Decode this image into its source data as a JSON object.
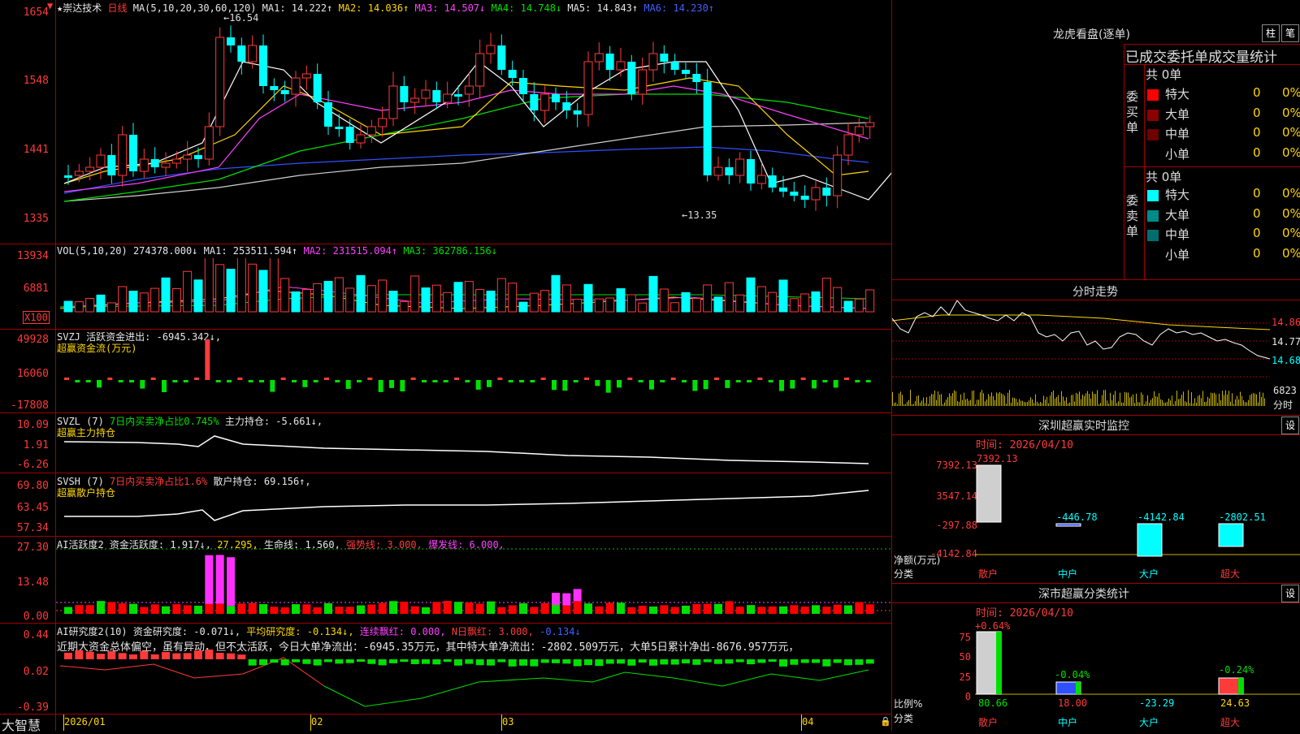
{
  "colors": {
    "up": "#ff3a3a",
    "down": "#00ffff",
    "ma1": "#ffffff",
    "ma2": "#ffd700",
    "ma3": "#ff40ff",
    "ma4": "#00e000",
    "ma5": "#cfcfcf",
    "ma6": "#3050ff"
  },
  "main": {
    "title": "★崇达技术",
    "period": "日线",
    "ma_params": "MA(5,10,20,30,60,120)",
    "ma1": "MA1: 14.222↑",
    "ma2": "MA2: 14.036↑",
    "ma3": "MA3: 14.507↓",
    "ma4": "MA4: 14.748↓",
    "ma5": "MA5: 14.843↑",
    "ma6": "MA6: 14.230↑",
    "y_ticks": [
      "1654",
      "1548",
      "1441",
      "1335"
    ],
    "high_label": "←16.54",
    "low_label": "←13.35"
  },
  "vol": {
    "label": "VOL(5,10,20)",
    "value": "274378.000↓",
    "ma1": "MA1: 253511.594↑",
    "ma2": "MA2: 231515.094↑",
    "ma3": "MA3: 362786.156↓",
    "y_ticks": [
      "13934",
      "6881",
      "X100"
    ]
  },
  "svzj": {
    "label": "SVZJ",
    "text": "活跃资金进出: -6945.342↓,",
    "sub": "超赢资金流(万元)",
    "y_ticks": [
      "49928",
      "16060",
      "-17808"
    ]
  },
  "svzl": {
    "label": "SVZL (7)",
    "text1": "7日内买卖净占比0.745%",
    "text2": "主力持仓: -5.661↓,",
    "sub": "超赢主力持仓",
    "y_ticks": [
      "10.09",
      "1.91",
      "-6.26"
    ]
  },
  "svsh": {
    "label": "SVSH (7)",
    "text1": "7日内买卖净占比1.6%",
    "text2": "散户持仓: 69.156↑,",
    "sub": "超赢散户持仓",
    "y_ticks": [
      "69.80",
      "63.45",
      "57.34"
    ]
  },
  "ai1": {
    "label": "AI活跃度2",
    "t1": "资金活跃度: 1.917↓,",
    "t2": "27.295,",
    "t3": "生命线: 1.560,",
    "t4": "强势线: 3.000,",
    "t5": "爆发线: 6.000,",
    "y_ticks": [
      "27.30",
      "13.48",
      "0.00"
    ]
  },
  "ai2": {
    "label": "AI研究度2(10)",
    "t1": "资金研究度: -0.071↓,",
    "t2": "平均研究度: -0.134↓,",
    "t3": "连续飘红: 0.000,",
    "t4": "N日飘红: 3.000,",
    "t5": "-0.134↓",
    "desc": "近期大资金总体偏空，虽有异动，但不太活跃，今日大单净流出：-6945.35万元，其中特大单净流出：-2802.509万元，大单5日累计净出-8676.957万元，",
    "y_ticks": [
      "0.44",
      "0.02",
      "-0.39"
    ]
  },
  "xaxis": {
    "brand": "大智慧",
    "labels": [
      "2026/01",
      "02",
      "03",
      "04"
    ]
  },
  "right": {
    "lhkp_title": "龙虎看盘(逐单)",
    "btn1": "柱",
    "btn2": "笔",
    "header": "已成交委托单成交量统计",
    "buy_side": "委买单",
    "sell_side": "委卖单",
    "buy_total": "共 0单",
    "sell_total": "共 0单",
    "buy_rows": [
      {
        "name": "特大",
        "num": "0",
        "pct": "0%"
      },
      {
        "name": "大单",
        "num": "0",
        "pct": "0%"
      },
      {
        "name": "中单",
        "num": "0",
        "pct": "0%"
      },
      {
        "name": "小单",
        "num": "0",
        "pct": "0%"
      }
    ],
    "sell_rows": [
      {
        "name": "特大",
        "num": "0",
        "pct": "0%"
      },
      {
        "name": "大单",
        "num": "0",
        "pct": "0%"
      },
      {
        "name": "中单",
        "num": "0",
        "pct": "0%"
      },
      {
        "name": "小单",
        "num": "0",
        "pct": "0%"
      }
    ],
    "fs_title": "分时走势",
    "fs_prices": [
      "14.86",
      "14.77",
      "14.68"
    ],
    "fs_vol": "6823",
    "fs_label": "分时",
    "m1_title": "深圳超赢实时监控",
    "m1_btn": "设",
    "m1_time": "时间: 2026/04/10",
    "m1_y": [
      "7392.13",
      "3547.14",
      "-297.88",
      "-4142.84"
    ],
    "m1_unit": "净额(万元)",
    "m1_cat": "分类",
    "m1_vals": [
      {
        "name": "散户",
        "val": "7392.13"
      },
      {
        "name": "中户",
        "val": "-446.78"
      },
      {
        "name": "大户",
        "val": "-4142.84"
      },
      {
        "name": "超大",
        "val": "-2802.51"
      }
    ],
    "m2_title": "深市超赢分类统计",
    "m2_btn": "设",
    "m2_time": "时间: 2026/04/10",
    "m2_y": [
      "75",
      "50",
      "25",
      "0"
    ],
    "m2_unit": "比例%",
    "m2_cat": "分类",
    "m2_tops": [
      "+0.64%",
      "-0.04%",
      "-0.24%"
    ],
    "m2_vals": [
      {
        "name": "散户",
        "val": "80.66"
      },
      {
        "name": "中户",
        "val": "18.00"
      },
      {
        "name": "大户",
        "val": "-23.29"
      },
      {
        "name": "超大",
        "val": "24.63"
      }
    ]
  }
}
